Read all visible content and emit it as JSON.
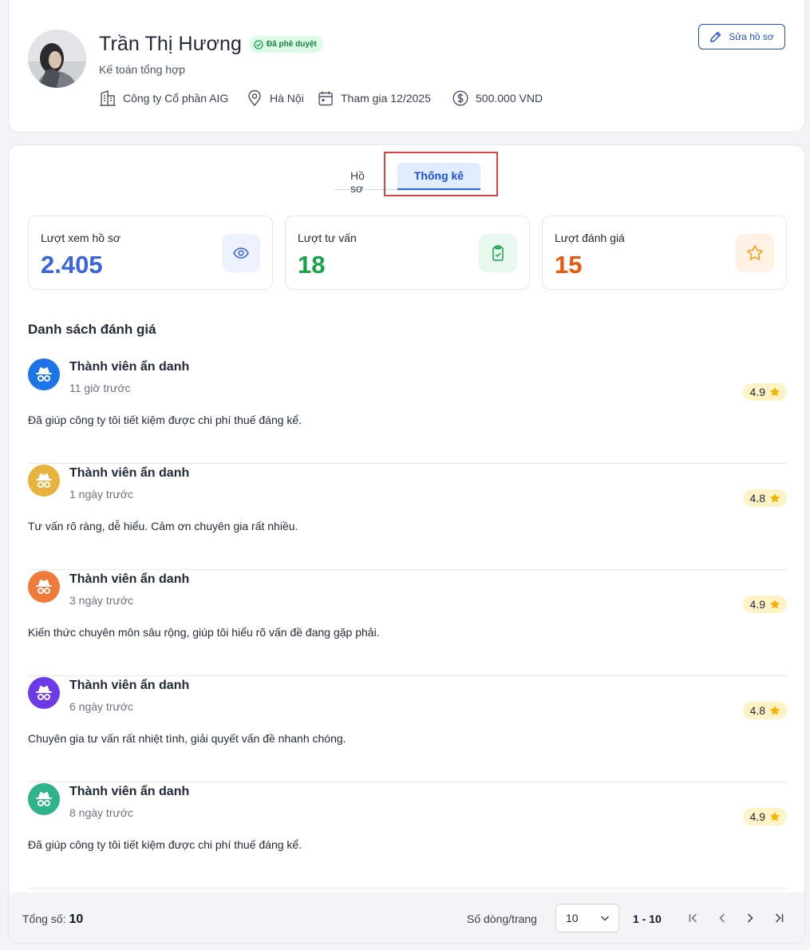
{
  "profile": {
    "name": "Trần Thị Hương",
    "verified_badge": "Đã phê duyệt",
    "role": "Kế toán tổng hợp",
    "company": "Công ty Cổ phần AIG",
    "location": "Hà Nội",
    "joined": "Tham gia 12/2025",
    "price": "500.000 VND",
    "edit_label": "Sửa hồ sơ"
  },
  "tabs": {
    "profile": "Hồ sơ",
    "stats": "Thống kê"
  },
  "stats": [
    {
      "label": "Lượt xem hồ sơ",
      "value": "2.405",
      "color": "#3b63e0",
      "icon": "eye-icon",
      "icon_bg": "#eef2ff"
    },
    {
      "label": "Lượt tư vấn",
      "value": "18",
      "color": "#16a34a",
      "icon": "clipboard-check-icon",
      "icon_bg": "#e7f8ee"
    },
    {
      "label": "Lượt đánh giá",
      "value": "15",
      "color": "#ea580c",
      "icon": "star-icon",
      "icon_bg": "#fff1e3"
    }
  ],
  "reviews_title": "Danh sách đánh giá",
  "reviews": [
    {
      "name": "Thành viên ẩn danh",
      "time": "11 giờ trước",
      "rating": "4.9",
      "text": "Đã giúp công ty tôi tiết kiệm được chi phí thuế đáng kể.",
      "avatar_color": "#1d74e8"
    },
    {
      "name": "Thành viên ẩn danh",
      "time": "1 ngày trước",
      "rating": "4.8",
      "text": "Tư vấn rõ ràng, dễ hiểu. Cảm ơn chuyên gia rất nhiều.",
      "avatar_color": "#e8b33c"
    },
    {
      "name": "Thành viên ẩn danh",
      "time": "3 ngày trước",
      "rating": "4.9",
      "text": "Kiến thức chuyên môn sâu rộng, giúp tôi hiểu rõ vấn đề đang gặp phải.",
      "avatar_color": "#f07a3a"
    },
    {
      "name": "Thành viên ẩn danh",
      "time": "6 ngày trước",
      "rating": "4.8",
      "text": "Chuyên gia tư vấn rất nhiệt tình, giải quyết vấn đề nhanh chóng.",
      "avatar_color": "#6d3ae8"
    },
    {
      "name": "Thành viên ẩn danh",
      "time": "8 ngày trước",
      "rating": "4.9",
      "text": "Đã giúp công ty tôi tiết kiệm được chi phí thuế đáng kể.",
      "avatar_color": "#2fb38a"
    }
  ],
  "footer": {
    "total_label": "Tổng số:",
    "total_value": "10",
    "rows_label": "Số dòng/trang",
    "rows_value": "10",
    "range": "1 - 10"
  },
  "colors": {
    "primary": "#1d4ed8",
    "rating_star": "#f5b400"
  }
}
